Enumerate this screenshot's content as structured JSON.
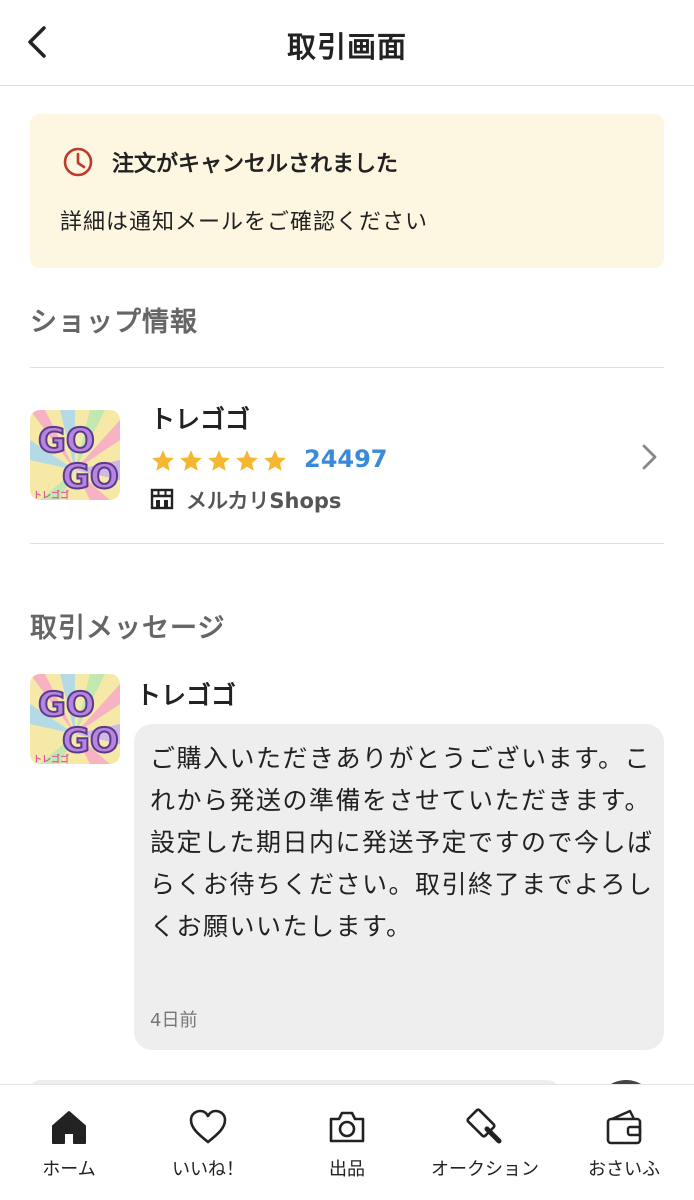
{
  "header": {
    "title": "取引画面"
  },
  "alert": {
    "title": "注文がキャンセルされました",
    "body": "詳細は通知メールをご確認ください",
    "icon": "clock-icon",
    "icon_color": "#c0392b"
  },
  "shop_section": {
    "title": "ショップ情報",
    "shop": {
      "name": "トレゴゴ",
      "rating_stars": 5,
      "rating_count": "24497",
      "badge_label": "メルカリShops",
      "logo_text": [
        "GO",
        "GO",
        "トレゴゴ"
      ]
    }
  },
  "message_section": {
    "title": "取引メッセージ",
    "messages": [
      {
        "sender": "トレゴゴ",
        "text": "ご購入いただきありがとうございます。これから発送の準備をさせていただきます。設定した期日内に発送予定ですので今しばらくお待ちください。取引終了までよろしくお願いいたします。",
        "time": "4日前"
      }
    ]
  },
  "tabbar": {
    "items": [
      {
        "label": "ホーム",
        "icon": "home-icon"
      },
      {
        "label": "いいね！",
        "icon": "heart-icon"
      },
      {
        "label": "出品",
        "icon": "camera-icon"
      },
      {
        "label": "オークション",
        "icon": "gavel-icon"
      },
      {
        "label": "おさいふ",
        "icon": "wallet-icon"
      }
    ]
  },
  "colors": {
    "alert_bg": "#fdf6e0",
    "star": "#f5b730",
    "rating_count": "#3b8ad9",
    "bubble_bg": "#eeeeee"
  }
}
